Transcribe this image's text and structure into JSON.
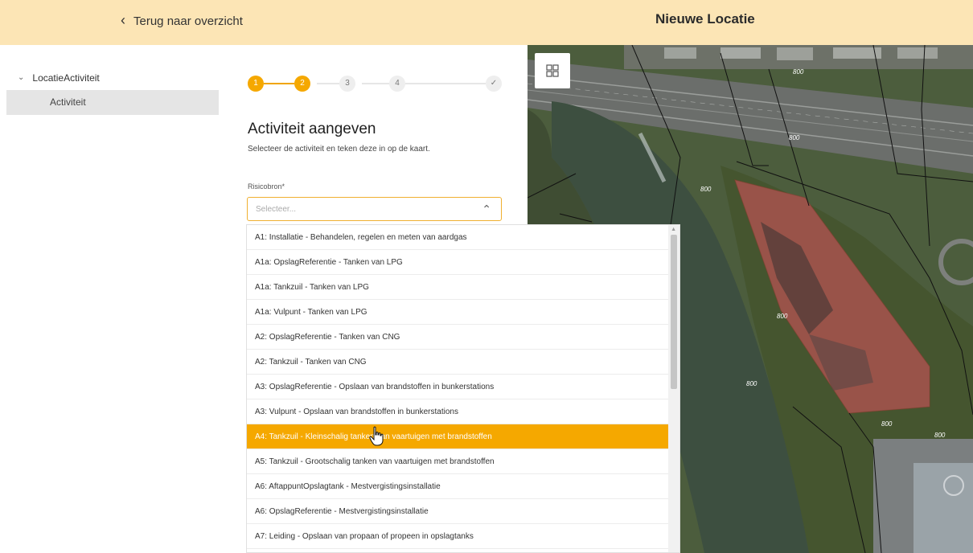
{
  "header": {
    "back_label": "Terug naar overzicht",
    "title": "Nieuwe Locatie"
  },
  "tree": {
    "parent_label": "LocatieActiviteit",
    "child_label": "Activiteit"
  },
  "stepper": {
    "steps": [
      "1",
      "2",
      "3",
      "4",
      "✓"
    ],
    "current_step": 2
  },
  "form": {
    "heading": "Activiteit aangeven",
    "subtext": "Selecteer de activiteit en teken deze in op de kaart.",
    "field_label": "Risicobron*",
    "placeholder": "Selecteer..."
  },
  "dropdown": {
    "options": [
      "A1: Installatie - Behandelen, regelen en meten van aardgas",
      "A1a: OpslagReferentie - Tanken van LPG",
      "A1a: Tankzuil - Tanken van LPG",
      "A1a: Vulpunt - Tanken van LPG",
      "A2: OpslagReferentie - Tanken van CNG",
      "A2: Tankzuil - Tanken van CNG",
      "A3: OpslagReferentie - Opslaan van brandstoffen in bunkerstations",
      "A3: Vulpunt - Opslaan van brandstoffen in bunkerstations",
      "A4: Tankzuil - Kleinschalig tanken van vaartuigen met brandstoffen",
      "A5: Tankzuil - Grootschalig tanken van vaartuigen met brandstoffen",
      "A6: AftappuntOpslagtank - Mestvergistingsinstallatie",
      "A6: OpslagReferentie - Mestvergistingsinstallatie",
      "A7: Leiding - Opslaan van propaan of propeen in opslagtanks"
    ],
    "selected_index": 8
  },
  "map": {
    "labels": [
      "800",
      "800",
      "800",
      "800",
      "800",
      "800",
      "800"
    ]
  },
  "colors": {
    "header_bg": "#fce5b5",
    "accent": "#f5a800",
    "selected_row": "#f5a800",
    "polygon": "#c0392b"
  },
  "icons": {
    "back": "chevron-left-icon",
    "tree_caret": "chevron-down-icon",
    "select": "chevron-up-icon",
    "map_layers": "grid-icon",
    "cursor": "hand-pointer-icon"
  }
}
